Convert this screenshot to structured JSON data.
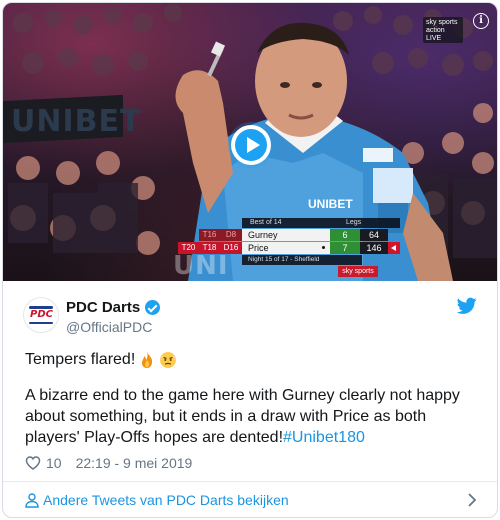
{
  "video": {
    "banner_text": "UNIBET",
    "banner_text_bottom": "UNI",
    "channel_logo": [
      "sky sports",
      "action",
      "LIVE"
    ],
    "info_icon": "info-icon",
    "play_icon": "play-icon",
    "scoreboard": {
      "best_of": "Best of 14",
      "legs_label": "Legs",
      "players": [
        {
          "checkout_left": "",
          "checkout_mid": "T16",
          "checkout_right": "D8",
          "name": "Gurney",
          "legs": "6",
          "points": "64",
          "throwing": false
        },
        {
          "checkout_left": "T20",
          "checkout_mid": "T18",
          "checkout_right": "D16",
          "name": "Price",
          "legs": "7",
          "points": "146",
          "throwing": true
        }
      ],
      "night": "Night 15 of 17 - Sheffield",
      "broadcaster": "sky sports"
    },
    "colors": {
      "legs_green": "#2f8f35",
      "score_red": "#d0142c"
    }
  },
  "tweet": {
    "avatar_text": "PDC",
    "display_name": "PDC Darts",
    "handle": "@OfficialPDC",
    "verified_icon": "verified-icon",
    "bird_icon": "twitter-bird-icon",
    "line1": "Tempers flared!",
    "emojis": [
      "fire-emoji",
      "angry-face-emoji"
    ],
    "body": "A bizarre end to the game here with Gurney clearly not happy about something, but it ends in a draw with Price as both players' Play-Offs hopes are dented!",
    "hashtag": "#Unibet180",
    "likes": "10",
    "timestamp": "22:19 - 9 mei 2019",
    "footer_link": "Andere Tweets van PDC Darts bekijken",
    "accent_color": "#1da1f2",
    "link_color": "#1b95e0"
  }
}
